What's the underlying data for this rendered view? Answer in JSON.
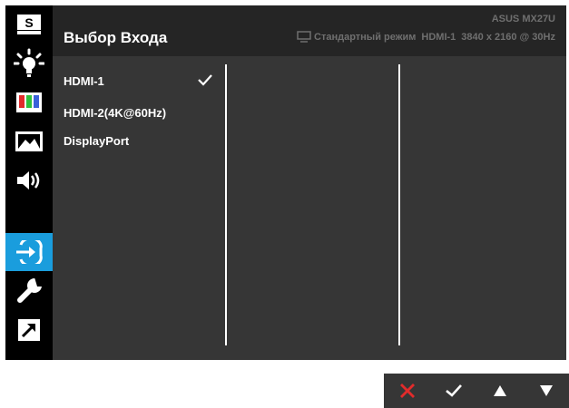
{
  "header": {
    "title": "Выбор Входа",
    "model": "ASUS MX27U",
    "status": {
      "mode": "Стандартный режим",
      "input": "HDMI-1",
      "resolution": "3840 x 2160 @ 30Hz"
    }
  },
  "sidebar": {
    "items": [
      {
        "icon": "splendid-icon",
        "label": "S"
      },
      {
        "icon": "brightness-icon"
      },
      {
        "icon": "color-icon"
      },
      {
        "icon": "image-icon"
      },
      {
        "icon": "sound-icon"
      },
      {
        "icon": "input-select-icon",
        "active": true
      },
      {
        "icon": "system-setup-icon"
      },
      {
        "icon": "shortcut-icon"
      }
    ]
  },
  "menu": {
    "items": [
      {
        "label": "HDMI-1",
        "selected": true
      },
      {
        "label": "HDMI-2(4K@60Hz)"
      },
      {
        "label": "DisplayPort"
      }
    ]
  },
  "colors": {
    "accent": "#1a9ddd",
    "close": "#e22b2b",
    "panel": "#363636",
    "header": "#252525"
  },
  "controls": [
    "close-icon",
    "check-icon",
    "up-arrow-icon",
    "down-arrow-icon"
  ]
}
